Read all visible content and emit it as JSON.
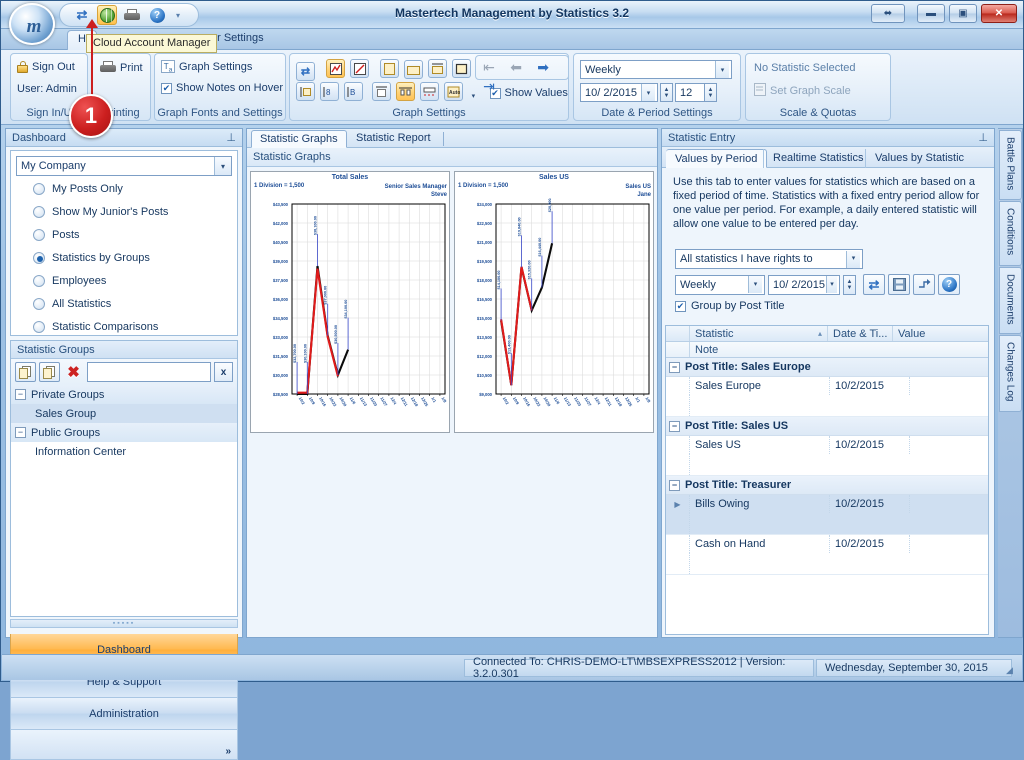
{
  "window": {
    "title": "Mastertech Management by Statistics 3.2",
    "orb_letter": "m",
    "restore_label": "⬌",
    "minimize_label": "▬",
    "maximize_label": "▣",
    "close_label": "✕"
  },
  "quick_access": {
    "refresh_icon": "refresh-icon",
    "cloud_icon": "cloud-account-manager-icon",
    "print_icon": "print-icon",
    "help_icon": "help-icon",
    "caret": "▾"
  },
  "callout": {
    "number": "1",
    "tooltip": "Cloud Account Manager"
  },
  "ribbon_tabs": [
    {
      "label": "H",
      "active": false
    },
    {
      "label": "er Settings",
      "active": false
    }
  ],
  "ribbon": {
    "groups": [
      {
        "title": "Sign In/U",
        "sign_out": "Sign Out",
        "user": "User: Admin"
      },
      {
        "title": "Printing",
        "print": "Print"
      },
      {
        "title": "Graph Fonts and Settings",
        "graph_settings": "Graph Settings",
        "show_notes": "Show Notes on Hover",
        "show_notes_checked": "✔"
      },
      {
        "title": "Graph Settings",
        "show_values": "Show Values",
        "show_values_checked": "✔",
        "auto_label": "Auto"
      },
      {
        "title": "Date & Period Settings",
        "period": "Weekly",
        "date": "10/ 2/2015",
        "count": "12"
      },
      {
        "title": "Scale & Quotas",
        "no_stat": "No Statistic Selected",
        "set_scale": "Set Graph Scale"
      }
    ]
  },
  "left_panel": {
    "header": "Dashboard",
    "pin": "📌",
    "company": "My Company",
    "radio_options": [
      {
        "label": "My Posts Only",
        "selected": false
      },
      {
        "label": "Show My Junior's Posts",
        "selected": false
      },
      {
        "label": "Posts",
        "selected": false
      },
      {
        "label": "Statistics by Groups",
        "selected": true
      },
      {
        "label": "Employees",
        "selected": false
      },
      {
        "label": "All Statistics",
        "selected": false
      },
      {
        "label": "Statistic Comparisons",
        "selected": false
      }
    ],
    "groups_title": "Statistic Groups",
    "search_value": "",
    "clear_label": "x",
    "tree": [
      {
        "label": "Private Groups",
        "type": "group",
        "expander": "−"
      },
      {
        "label": "Sales Group",
        "type": "child",
        "selected": true
      },
      {
        "label": "Public Groups",
        "type": "group",
        "expander": "−"
      },
      {
        "label": "Information Center",
        "type": "child",
        "selected": false
      }
    ],
    "nav_buttons": [
      {
        "label": "Dashboard",
        "active": true
      },
      {
        "label": "Help & Support",
        "active": false
      },
      {
        "label": "Administration",
        "active": false
      }
    ],
    "nav_more": "»"
  },
  "center_panel": {
    "tabs": [
      {
        "label": "Statistic Graphs",
        "active": true
      },
      {
        "label": "Statistic Report",
        "active": false
      }
    ],
    "header": "Statistic Graphs"
  },
  "chart_data": [
    {
      "type": "line",
      "title": "Total Sales",
      "scale_note": "1 Division = 1,500",
      "owner": "Senior Sales Manager",
      "owner_name": "Steve",
      "ylabel": "",
      "xlabel": "",
      "ylim": [
        28500,
        43500
      ],
      "yticks": [
        28500,
        30000,
        31500,
        33000,
        34500,
        36000,
        37500,
        39000,
        40500,
        42000,
        43500
      ],
      "ytick_labels": [
        "$28,500",
        "$30,000",
        "$31,500",
        "$33,000",
        "$34,500",
        "$36,000",
        "$37,500",
        "$39,000",
        "$40,500",
        "$42,000",
        "$43,500"
      ],
      "categories": [
        "10/2",
        "10/9",
        "10/16",
        "10/23",
        "10/30",
        "11/6",
        "11/13",
        "11/20",
        "11/27",
        "12/4",
        "12/11",
        "12/18",
        "12/25",
        "1/1",
        "1/8"
      ],
      "grid": true,
      "series": [
        {
          "name": "Value",
          "color": "#0b0b0b",
          "values": [
            28500,
            28500,
            38600,
            33100,
            30000,
            32000,
            null,
            null,
            null,
            null,
            null,
            null,
            null,
            null,
            null
          ]
        },
        {
          "name": "Trend",
          "color": "#e01b1b",
          "values": [
            28600,
            28600,
            38400,
            33000,
            29900,
            null,
            null,
            null,
            null,
            null,
            null,
            null,
            null,
            null,
            null
          ]
        }
      ],
      "point_labels": [
        "$32,700.00",
        "$30,100.00",
        "$38,100.00",
        "$37,000.00",
        "$30,500.00",
        "$34,100.00"
      ]
    },
    {
      "type": "line",
      "title": "Sales US",
      "scale_note": "1 Division = 1,500",
      "owner": "Sales US",
      "owner_name": "Jane",
      "ylabel": "",
      "xlabel": "",
      "ylim": [
        9000,
        24000
      ],
      "yticks": [
        9000,
        10500,
        12000,
        13500,
        15000,
        16500,
        18000,
        19500,
        21000,
        22500,
        24000
      ],
      "ytick_labels": [
        "$9,000",
        "$10,500",
        "$12,000",
        "$13,500",
        "$15,000",
        "$16,500",
        "$18,000",
        "$19,500",
        "$21,000",
        "$22,500",
        "$24,000"
      ],
      "categories": [
        "10/2",
        "10/9",
        "10/16",
        "10/23",
        "10/30",
        "11/6",
        "11/13",
        "11/20",
        "11/27",
        "12/4",
        "12/11",
        "12/18",
        "12/25",
        "1/1",
        "1/8"
      ],
      "grid": true,
      "series": [
        {
          "name": "Value",
          "color": "#0b0b0b",
          "values": [
            14800,
            9700,
            19000,
            15600,
            17400,
            20900,
            null,
            null,
            null,
            null,
            null,
            null,
            null,
            null,
            null
          ]
        },
        {
          "name": "Trend",
          "color": "#e01b1b",
          "values": [
            14900,
            9700,
            19050,
            15600,
            null,
            null,
            null,
            null,
            null,
            null,
            null,
            null,
            null,
            null,
            null
          ]
        }
      ],
      "point_labels": [
        "$14,100.00",
        "$13,400.00",
        "$19,840.00",
        "$15,320.00",
        "$16,440.00",
        "$20,900.00"
      ]
    }
  ],
  "right_panel": {
    "header": "Statistic Entry",
    "pin": "📌",
    "tabs": [
      {
        "label": "Values by Period",
        "active": true
      },
      {
        "label": "Realtime Statistics",
        "active": false
      },
      {
        "label": "Values by Statistic",
        "active": false
      }
    ],
    "description": "Use this tab to enter values for statistics which are based on a fixed period of time. Statistics with a fixed entry period allow for one value per period. For example, a daily entered statistic will allow one value to be entered per day.",
    "scope": "All statistics I have rights to",
    "period": "Weekly",
    "date": "10/ 2/2015",
    "group_by_label": "Group by Post Title",
    "group_by_checked": "✔",
    "action_icons": [
      "refresh-icon",
      "save-icon",
      "import-icon",
      "help-icon"
    ],
    "grid": {
      "columns": [
        "Statistic",
        "Date & Ti...",
        "Value"
      ],
      "sort_indicator": "▴",
      "note_label": "Note",
      "groups": [
        {
          "label": "Post Title:  Sales Europe",
          "expander": "−",
          "rows": [
            {
              "statistic": "Sales Europe",
              "date": "10/2/2015",
              "value": "",
              "selected": false
            }
          ]
        },
        {
          "label": "Post Title:  Sales US",
          "expander": "−",
          "rows": [
            {
              "statistic": "Sales US",
              "date": "10/2/2015",
              "value": "",
              "selected": false
            }
          ]
        },
        {
          "label": "Post Title:  Treasurer",
          "expander": "−",
          "rows": [
            {
              "statistic": "Bills Owing",
              "date": "10/2/2015",
              "value": "",
              "selected": true
            },
            {
              "statistic": "Cash on Hand",
              "date": "10/2/2015",
              "value": "",
              "selected": false
            }
          ]
        }
      ]
    }
  },
  "side_tabs": [
    {
      "label": "Battle Plans"
    },
    {
      "label": "Conditions"
    },
    {
      "label": "Documents"
    },
    {
      "label": "Changes Log"
    }
  ],
  "status_bar": {
    "connection": "Connected To: CHRIS-DEMO-LT\\MBSEXPRESS2012 | Version: 3.2.0.301",
    "date": "Wednesday, September 30, 2015"
  },
  "colors": {
    "accent": "#1d62ad",
    "highlight": "#ffb84d",
    "series_black": "#0b0b0b",
    "series_red": "#e01b1b",
    "label_blue": "#1d4d96"
  }
}
